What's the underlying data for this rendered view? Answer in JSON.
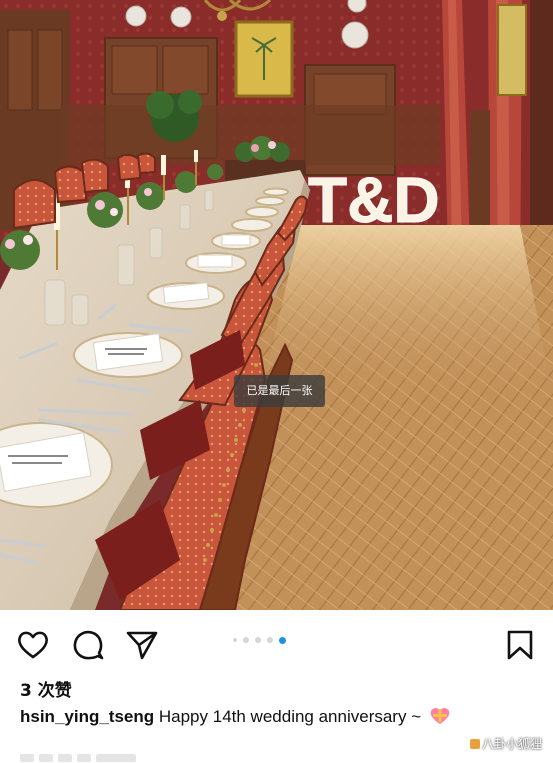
{
  "post": {
    "toast": "已是最后一张",
    "likes": "3 次赞",
    "username": "hsin_ying_tseng",
    "caption": "Happy 14th wedding anniversary ~",
    "caption_emoji": "heart-gift-emoji",
    "carousel": {
      "total": 5,
      "active_index": 4
    }
  },
  "scene": {
    "marquee_letters": "T&D"
  },
  "actions": {
    "like_icon": "heart-icon",
    "comment_icon": "comment-icon",
    "share_icon": "send-icon",
    "save_icon": "bookmark-icon"
  },
  "watermark": {
    "text": "八卦小狐狸"
  },
  "colors": {
    "accent_dot": "#1e90e8",
    "wall": "#7a2a2a",
    "floor": "#c89a62"
  }
}
